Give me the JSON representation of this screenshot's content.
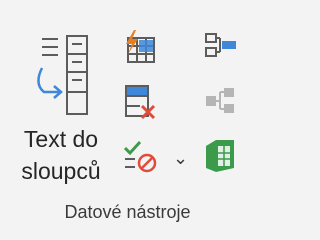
{
  "group": {
    "label": "Datové nástroje"
  },
  "text_to_columns": {
    "label_line1": "Text do",
    "label_line2": "sloupců",
    "icon": "text-to-columns-icon"
  },
  "small_buttons": {
    "flash_fill": {
      "icon": "flash-fill-icon"
    },
    "remove_duplicates": {
      "icon": "remove-duplicates-icon"
    },
    "data_validation": {
      "icon": "data-validation-icon"
    },
    "data_validation_dropdown": {
      "glyph": "⌄",
      "icon": "chevron-down-icon"
    },
    "consolidate": {
      "icon": "consolidate-icon"
    },
    "relationships": {
      "icon": "relationships-icon"
    },
    "data_model": {
      "icon": "data-model-icon"
    }
  },
  "colors": {
    "background": "#f3f3f3",
    "text": "#262626",
    "icon_gray": "#5c5c5c",
    "accent_blue": "#3e87d9",
    "accent_orange": "#e67e22",
    "accent_red": "#e04b3a",
    "accent_green": "#3b9b4a"
  }
}
